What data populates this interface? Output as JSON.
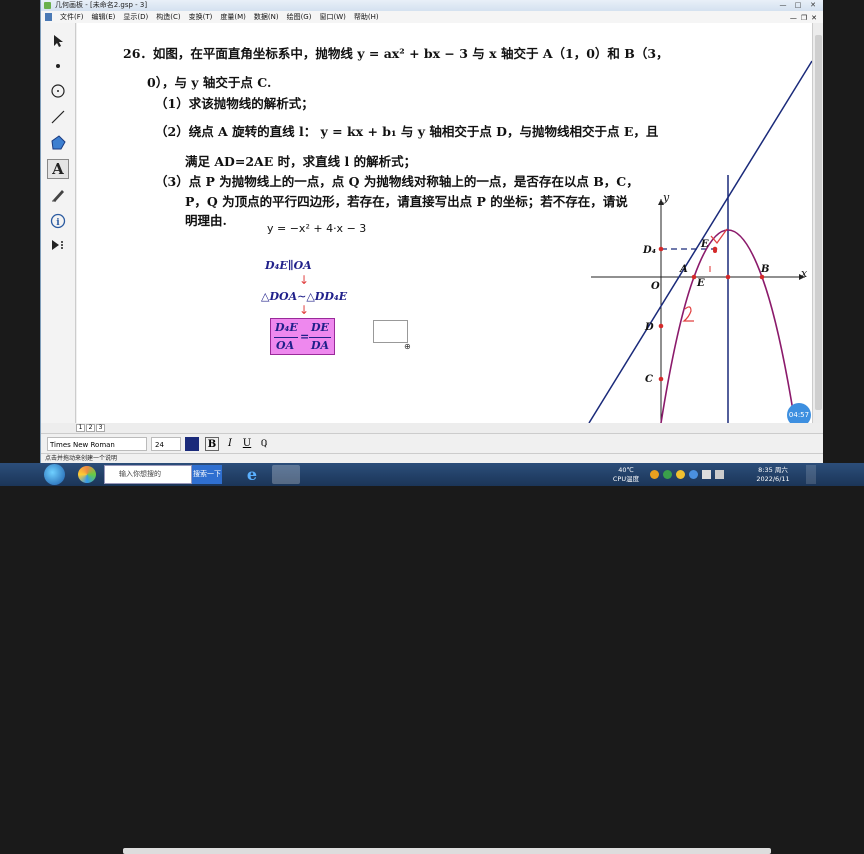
{
  "window": {
    "title": "几何画板 - [未命名2.gsp - 3]",
    "menus": [
      "文件(F)",
      "编辑(E)",
      "显示(D)",
      "构造(C)",
      "变换(T)",
      "度量(M)",
      "数据(N)",
      "绘图(G)",
      "窗口(W)",
      "帮助(H)"
    ]
  },
  "tools": [
    "arrow-tool",
    "point-tool",
    "compass-tool",
    "line-tool",
    "polygon-tool",
    "text-tool",
    "marker-tool",
    "info-tool",
    "custom-tool"
  ],
  "problem": {
    "line1": "26．如图，在平面直角坐标系中，抛物线 y = ax² + bx − 3 与 x 轴交于 A（1，0）和 B（3，",
    "line2": "0），与 y 轴交于点 C.",
    "part1": "（1）求该抛物线的解析式；",
    "part2a": "（2）绕点 A 旋转的直线 l：  y = kx + b₁ 与 y 轴相交于点 D，与抛物线相交于点 E，且",
    "part2b": "满足 AD=2AE 时，求直线 l 的解析式；",
    "part3a": "（3）点 P 为抛物线上的一点，点 Q 为抛物线对称轴上的一点，是否存在以点 B，C，",
    "part3b": "P，Q 为顶点的平行四边形，若存在，请直接写出点 P 的坐标；若不存在，请说",
    "part3c": "明理由."
  },
  "annotations": {
    "function": "y = −x² + 4·x − 3",
    "parallel": "D₄E∥OA",
    "similar": "△DOA∼△DD₄E",
    "frac_left_num": "D₄E",
    "frac_left_den": "OA",
    "equals": "=",
    "frac_right_num": "DE",
    "frac_right_den": "DA"
  },
  "graph_labels": {
    "y": "y",
    "x": "x",
    "O": "O",
    "A": "A",
    "B": "B",
    "C": "C",
    "D": "D",
    "D4": "D₄",
    "E_top": "E",
    "E_bottom": "E",
    "hand_1": "1",
    "hand_2": "2"
  },
  "colors": {
    "parabola": "#8b1a6b",
    "line": "#1a2a7a",
    "point": "#d42a2a",
    "handwriting": "#e04040"
  },
  "pages": [
    "1",
    "2",
    "3"
  ],
  "format": {
    "font": "Times New Roman",
    "size": "24",
    "bold": "B",
    "italic": "I",
    "underline": "U"
  },
  "status": "点击并拖动来创建一个说明",
  "timer": "04:57",
  "taskbar": {
    "search_placeholder": "输入你想搜的",
    "search_button": "搜索一下",
    "temp": "40℃",
    "temp_label": "CPU温度",
    "time": "8:35 周六",
    "date": "2022/6/11"
  }
}
